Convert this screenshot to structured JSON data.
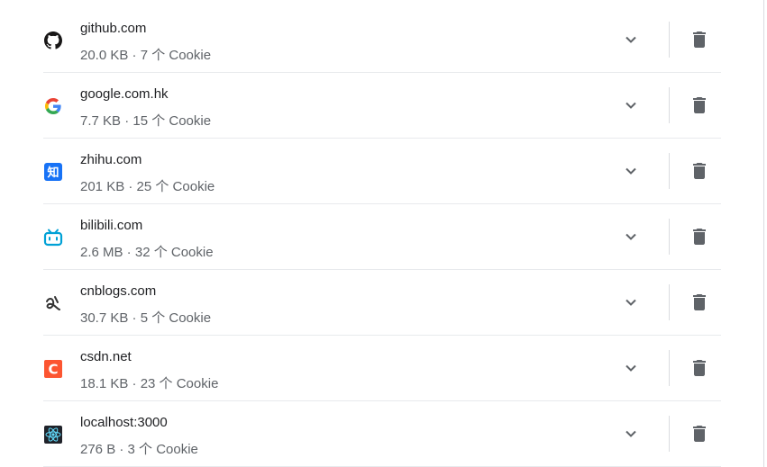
{
  "sites": [
    {
      "name": "github.com",
      "meta": "20.0 KB · 7 个 Cookie",
      "icon": "github-icon"
    },
    {
      "name": "google.com.hk",
      "meta": "7.7 KB · 15 个 Cookie",
      "icon": "google-icon"
    },
    {
      "name": "zhihu.com",
      "meta": "201 KB · 25 个 Cookie",
      "icon": "zhihu-icon",
      "icon_text": "知"
    },
    {
      "name": "bilibili.com",
      "meta": "2.6 MB · 32 个 Cookie",
      "icon": "bilibili-icon"
    },
    {
      "name": "cnblogs.com",
      "meta": "30.7 KB · 5 个 Cookie",
      "icon": "cnblogs-icon"
    },
    {
      "name": "csdn.net",
      "meta": "18.1 KB · 23 个 Cookie",
      "icon": "csdn-icon",
      "icon_text": "C"
    },
    {
      "name": "localhost:3000",
      "meta": "276 B · 3 个 Cookie",
      "icon": "react-icon"
    }
  ],
  "actions": {
    "expand_icon": "chevron-down-icon",
    "delete_icon": "trash-icon"
  },
  "colors": {
    "icon_gray": "#5f6368",
    "zhihu_blue": "#1772f6",
    "bilibili_blue": "#00a1d6",
    "csdn_red": "#fc5531",
    "react_cyan": "#61dafb"
  }
}
